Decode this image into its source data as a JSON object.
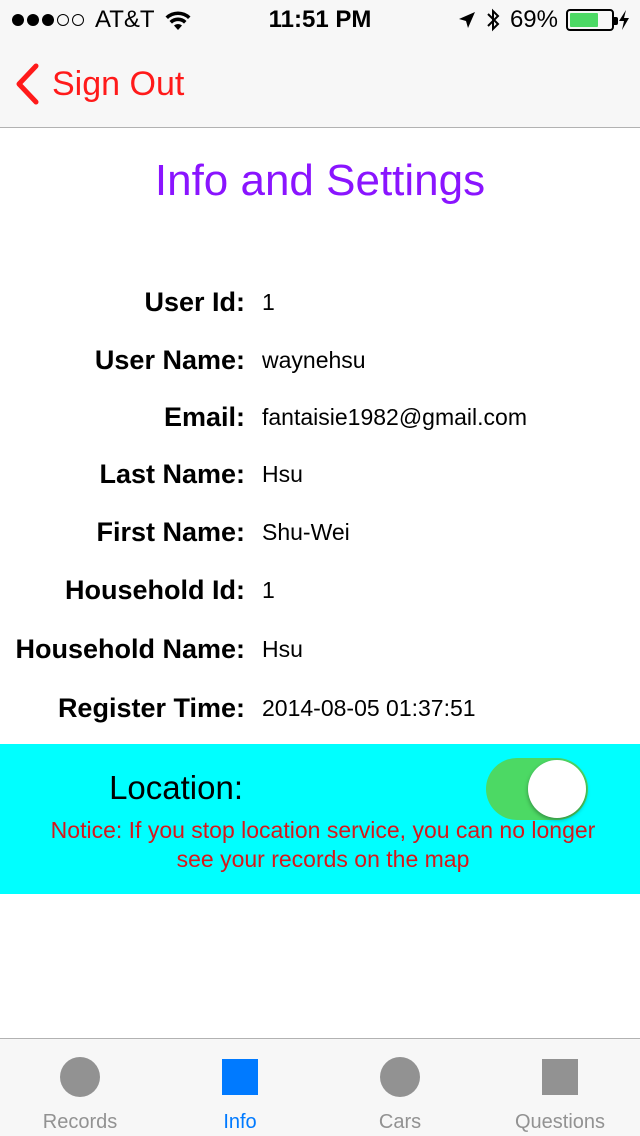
{
  "status_bar": {
    "carrier": "AT&T",
    "time": "11:51 PM",
    "battery_percent": "69%",
    "battery_level": 0.69,
    "signal_bars_filled": 3,
    "signal_bars_total": 5
  },
  "nav_bar": {
    "back_label": "Sign Out",
    "accent_color": "#ff1a1a"
  },
  "page": {
    "title": "Info and Settings",
    "title_color": "#8a14ff"
  },
  "info": {
    "rows": [
      {
        "label": "User Id:",
        "value": "1"
      },
      {
        "label": "User Name:",
        "value": "waynehsu"
      },
      {
        "label": "Email:",
        "value": "fantaisie1982@gmail.com"
      },
      {
        "label": "Last Name:",
        "value": "Hsu"
      },
      {
        "label": "First Name:",
        "value": "Shu-Wei"
      },
      {
        "label": "Household Id:",
        "value": "1"
      },
      {
        "label": "Household Name:",
        "value": "Hsu"
      },
      {
        "label": "Register Time:",
        "value": "2014-08-05 01:37:51"
      }
    ]
  },
  "location": {
    "label": "Location:",
    "enabled": true,
    "notice": "Notice: If you stop location service, you can no longer see your records on the map",
    "panel_color": "#00ffff",
    "notice_color": "#d6171b"
  },
  "tab_bar": {
    "tabs": [
      {
        "label": "Records",
        "icon": "circle-icon",
        "active": false
      },
      {
        "label": "Info",
        "icon": "square-icon",
        "active": true
      },
      {
        "label": "Cars",
        "icon": "circle-icon",
        "active": false
      },
      {
        "label": "Questions",
        "icon": "square-icon",
        "active": false
      }
    ],
    "active_color": "#007aff",
    "inactive_color": "#929292"
  }
}
